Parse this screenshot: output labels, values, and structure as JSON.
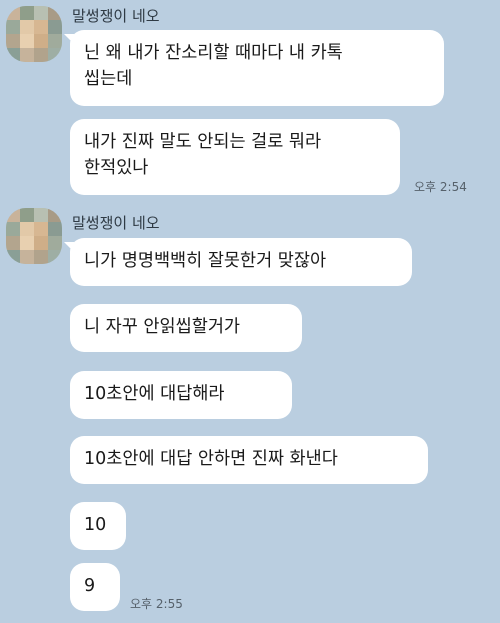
{
  "chat": {
    "group1": {
      "sender": "말썽쟁이 네오",
      "messages": [
        "닌 왜 내가 잔소리할 때마다 내 카톡\n씹는데",
        "내가 진짜 말도 안되는 걸로 뭐라\n한적있나"
      ],
      "time": "오후 2:54"
    },
    "group2": {
      "sender": "말썽쟁이 네오",
      "messages": [
        "니가 명명백백히 잘못한거 맞잖아",
        "니 자꾸 안읽씹할거가",
        "10초안에 대답해라",
        "10초안에 대답 안하면 진짜 화낸다",
        "10",
        "9"
      ],
      "time": "오후 2:55"
    }
  },
  "colors": {
    "background": "#bacee0",
    "bubble": "#ffffff"
  },
  "icons": {
    "avatar": "blurred-profile-avatar-icon"
  }
}
